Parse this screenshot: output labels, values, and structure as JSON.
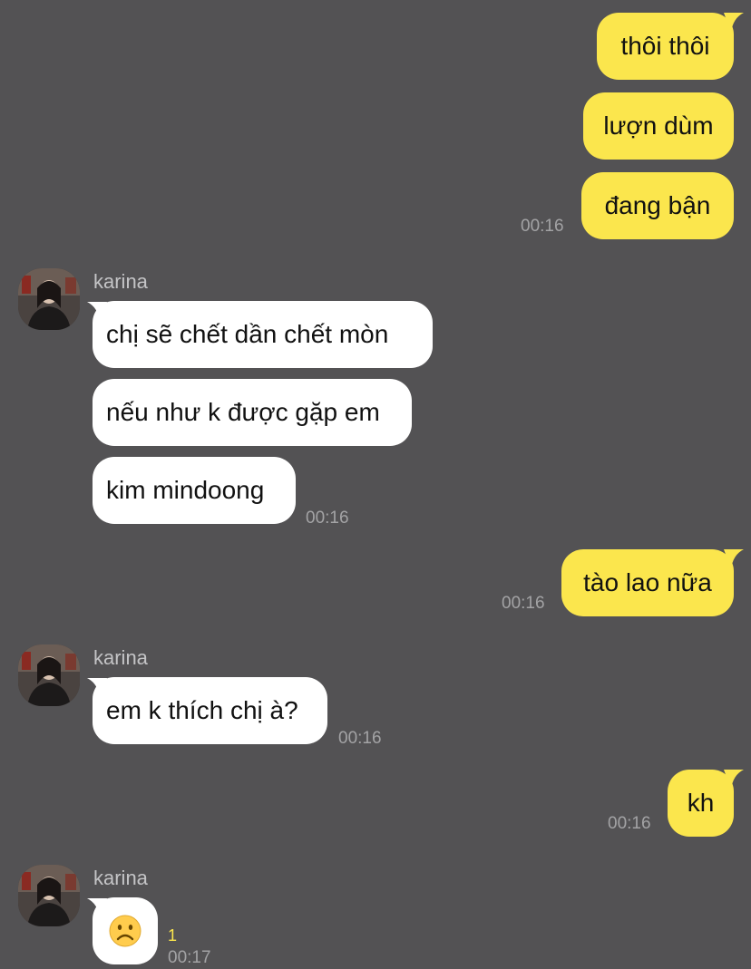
{
  "conversation": {
    "sender_name": "karina",
    "messages": [
      {
        "direction": "out",
        "text": "thôi thôi"
      },
      {
        "direction": "out",
        "text": "lượn dùm"
      },
      {
        "direction": "out",
        "text": "đang bận",
        "time": "00:16"
      },
      {
        "direction": "in",
        "text": "chị sẽ chết dần chết mòn"
      },
      {
        "direction": "in",
        "text": "nếu như k được gặp em"
      },
      {
        "direction": "in",
        "text": "kim mindoong",
        "time": "00:16"
      },
      {
        "direction": "out",
        "text": "tào lao nữa",
        "time": "00:16"
      },
      {
        "direction": "in",
        "text": "em k thích chị à?",
        "time": "00:16"
      },
      {
        "direction": "out",
        "text": "kh",
        "time": "00:16"
      },
      {
        "direction": "in",
        "text": "☹",
        "time": "00:17",
        "unread": "1"
      }
    ]
  },
  "colors": {
    "background": "#535254",
    "outgoing_bubble": "#FBE64D",
    "incoming_bubble": "#FFFFFF",
    "timestamp": "#A3A3A5",
    "unread_count": "#FBE64D"
  },
  "icons": {
    "avatar": "profile-photo",
    "reaction": "frowning-face-emoji"
  }
}
